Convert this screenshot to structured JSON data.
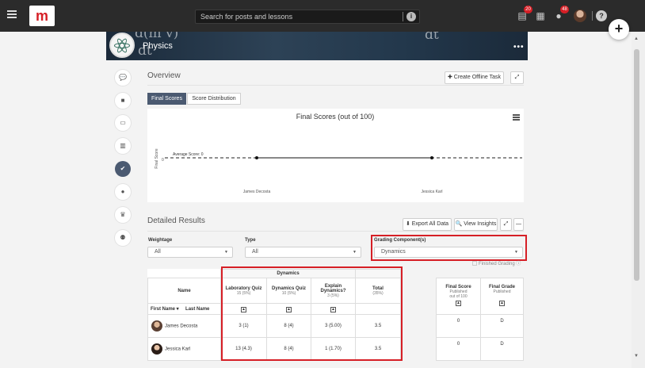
{
  "topbar": {
    "search_placeholder": "Search for posts and lessons",
    "badge_assignments": "20",
    "badge_notifications": "48"
  },
  "banner": {
    "course_title": "Physics",
    "more_label": "•••",
    "chalk_left": "d(m v)",
    "chalk_dt": "dt",
    "chalk_right": "dt"
  },
  "overview": {
    "title": "Overview",
    "create_task_label": "✚ Create Offline Task",
    "expand_label": "⤢",
    "tabs": [
      {
        "label": "Final Scores"
      },
      {
        "label": "Score Distribution"
      }
    ]
  },
  "chart_data": {
    "type": "line",
    "title": "Final Scores (out of 100)",
    "ylabel": "Final Score",
    "categories": [
      "James Decosta",
      "Jessica Karl"
    ],
    "series": [
      {
        "values": [
          0,
          0
        ]
      }
    ],
    "reference_line": {
      "label": "Average Score: 0",
      "value": 0
    },
    "y_tick_labels": [
      "0"
    ]
  },
  "detailed": {
    "title": "Detailed Results",
    "export_label": "⬇ Export All Data",
    "insights_label": "🔍 View Insights",
    "expand_label": "⤢",
    "collapse_label": "—"
  },
  "filters": {
    "weightage_label": "Weightage",
    "weightage_value": "All",
    "type_label": "Type",
    "type_value": "All",
    "grading_label": "Grading Component(s)",
    "grading_value": "Dynamics",
    "finished_grading_label": "Finished Grading"
  },
  "results_table": {
    "name_header": "Name",
    "first_name_header": "First Name ▾",
    "last_name_header": "Last Name",
    "group_header": "Dynamics",
    "columns": [
      {
        "label": "Laboratory Quiz",
        "weight": "15 (5%)"
      },
      {
        "label": "Dynamics Quiz",
        "weight": "10 (5%)"
      },
      {
        "label": "Explain Dynamics?",
        "weight": "3 (5%)"
      },
      {
        "label": "Total",
        "weight": "(35%)"
      }
    ],
    "rows": [
      {
        "name": "James Decosta",
        "cells": [
          "3 (1)",
          "8 (4)",
          "3 (5.00)",
          "3.5"
        ]
      },
      {
        "name": "Jessica Karl",
        "cells": [
          "13 (4.3)",
          "8 (4)",
          "1 (1.70)",
          "3.5"
        ]
      }
    ]
  },
  "final_table": {
    "final_score_header": "Final Score",
    "final_score_sub1": "Published",
    "final_score_sub2": "out of 100",
    "final_grade_header": "Final Grade",
    "final_grade_sub": "Published",
    "rows": [
      {
        "score": "0",
        "grade": "D"
      },
      {
        "score": "0",
        "grade": "D"
      }
    ]
  }
}
